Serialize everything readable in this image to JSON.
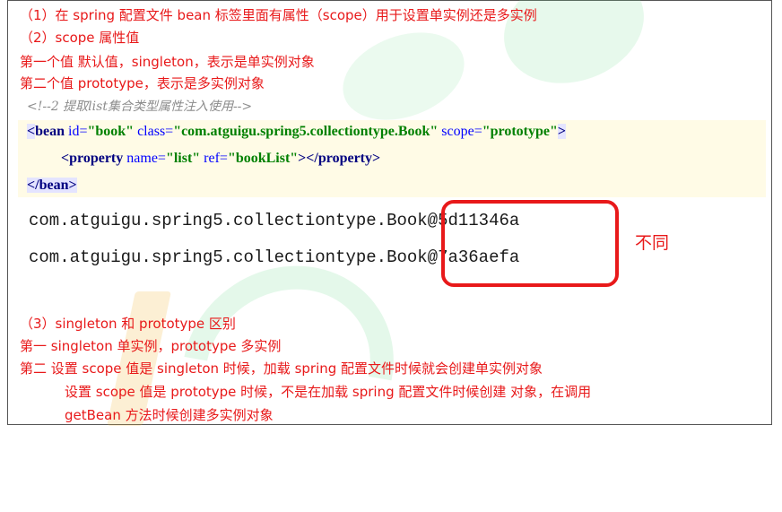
{
  "lines": {
    "l1": "（1）在 spring 配置文件 bean 标签里面有属性（scope）用于设置单实例还是多实例",
    "l2": "（2）scope 属性值",
    "l3": "第一个值  默认值，singleton，表示是单实例对象",
    "l4": "第二个值  prototype，表示是多实例对象"
  },
  "code": {
    "comment": "<!--2 提取list集合类型属性注入使用-->",
    "bean_open_lt": "<",
    "bean_tag": "bean",
    "bean_attr_id": " id=",
    "bean_val_id": "\"book\"",
    "bean_attr_class": " class=",
    "bean_val_class": "\"com.atguigu.spring5.collectiontype.Book\"",
    "bean_attr_scope": " scope=",
    "bean_val_scope": "\"prototype\"",
    "bean_open_gt": ">",
    "prop_open": "<property",
    "prop_attr_name": " name=",
    "prop_val_name": "\"list\"",
    "prop_attr_ref": " ref=",
    "prop_val_ref": "\"bookList\"",
    "prop_close": "></property>",
    "bean_close": "</bean>"
  },
  "output": {
    "line1": "com.atguigu.spring5.collectiontype.Book@5d11346a",
    "line2": "com.atguigu.spring5.collectiontype.Book@7a36aefa",
    "note": "不同"
  },
  "section3": {
    "l1": "（3）singleton 和 prototype 区别",
    "l2": "第一  singleton 单实例，prototype 多实例",
    "l3": "第二  设置 scope 值是 singleton 时候，加载 spring 配置文件时候就会创建单实例对象",
    "l4": "设置  scope  值是  prototype  时候，不是在加载  spring  配置文件时候创建  对象，在调用",
    "l5": "getBean 方法时候创建多实例对象"
  }
}
